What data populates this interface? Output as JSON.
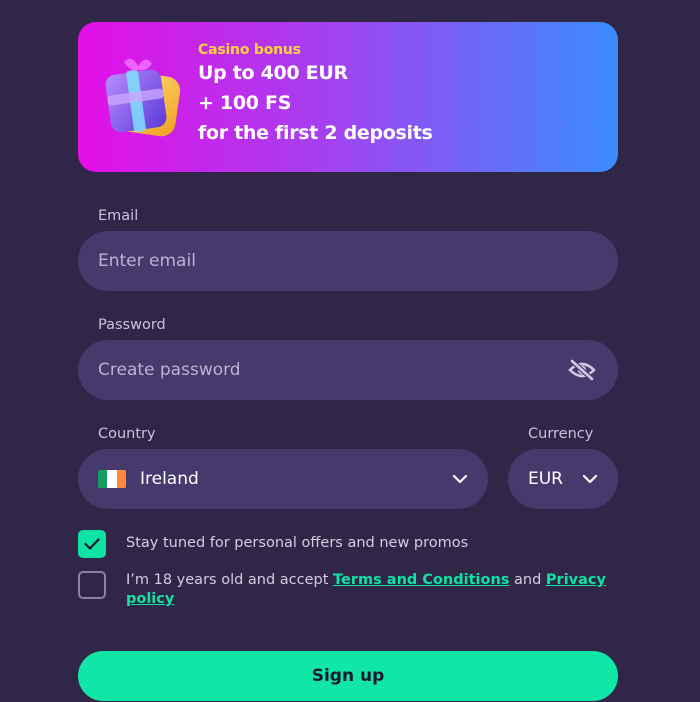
{
  "banner": {
    "kicker": "Casino bonus",
    "line1": "Up to 400 EUR",
    "line2": "+ 100 FS",
    "line3": "for the first 2 deposits"
  },
  "email": {
    "label": "Email",
    "placeholder": "Enter email"
  },
  "password": {
    "label": "Password",
    "placeholder": "Create password",
    "visibility_icon": "eye-slash-icon"
  },
  "country": {
    "label": "Country",
    "value": "Ireland",
    "flag_colors": [
      "#169b62",
      "#ffffff",
      "#ff883e"
    ]
  },
  "currency": {
    "label": "Currency",
    "value": "EUR"
  },
  "promos_checkbox": {
    "checked": true,
    "text": "Stay tuned for personal offers and new promos"
  },
  "terms_checkbox": {
    "checked": false,
    "text_before": "I’m 18 years old and accept ",
    "terms_link": "Terms and Conditions",
    "text_between": " and ",
    "privacy_link": "Privacy policy"
  },
  "signup": {
    "label": "Sign up"
  },
  "colors": {
    "background": "#2f2648",
    "field": "#463a6d",
    "accent": "#10e7a6",
    "kicker": "#ffd23f"
  }
}
